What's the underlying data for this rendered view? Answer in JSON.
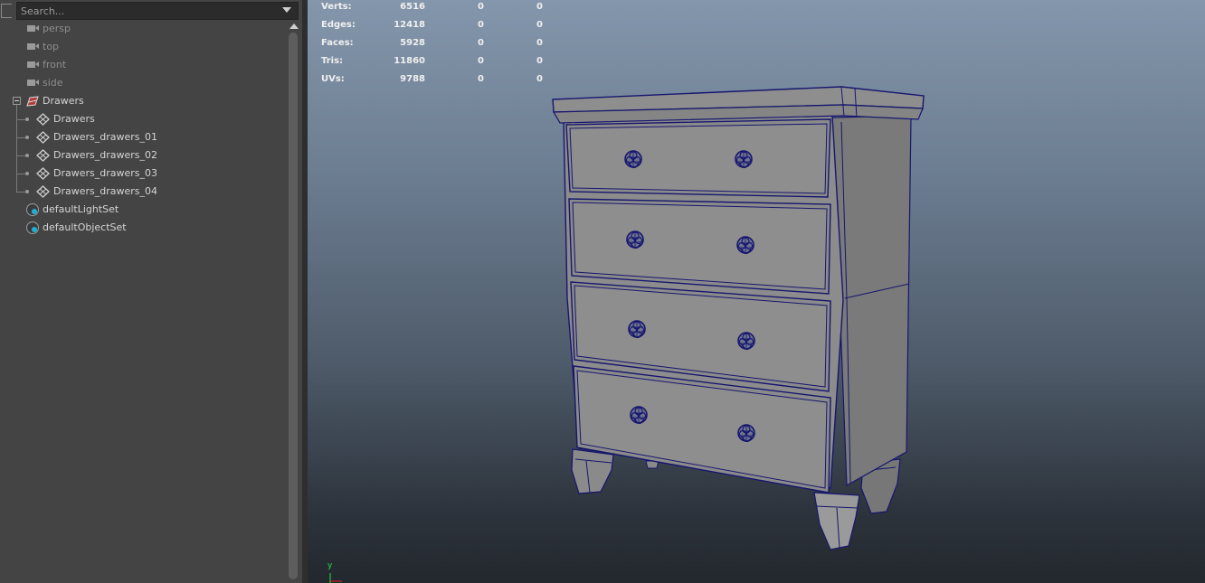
{
  "outliner": {
    "search": {
      "placeholder": "Search..."
    },
    "items": [
      {
        "label": "persp"
      },
      {
        "label": "top"
      },
      {
        "label": "front"
      },
      {
        "label": "side"
      },
      {
        "label": "Drawers"
      },
      {
        "label": "Drawers"
      },
      {
        "label": "Drawers_drawers_01"
      },
      {
        "label": "Drawers_drawers_02"
      },
      {
        "label": "Drawers_drawers_03"
      },
      {
        "label": "Drawers_drawers_04"
      },
      {
        "label": "defaultLightSet"
      },
      {
        "label": "defaultObjectSet"
      }
    ]
  },
  "viewport": {
    "hud": [
      {
        "label": "Verts:",
        "v1": "6516",
        "v2": "0",
        "v3": "0"
      },
      {
        "label": "Edges:",
        "v1": "12418",
        "v2": "0",
        "v3": "0"
      },
      {
        "label": "Faces:",
        "v1": "5928",
        "v2": "0",
        "v3": "0"
      },
      {
        "label": "Tris:",
        "v1": "11860",
        "v2": "0",
        "v3": "0"
      },
      {
        "label": "UVs:",
        "v1": "9788",
        "v2": "0",
        "v3": "0"
      }
    ],
    "axis_y_label": "y"
  },
  "colors": {
    "wireframe": "#16166e",
    "axis_y": "#20e040",
    "axis_x": "#e02020",
    "set_icon_accent": "#1fb0d8"
  }
}
